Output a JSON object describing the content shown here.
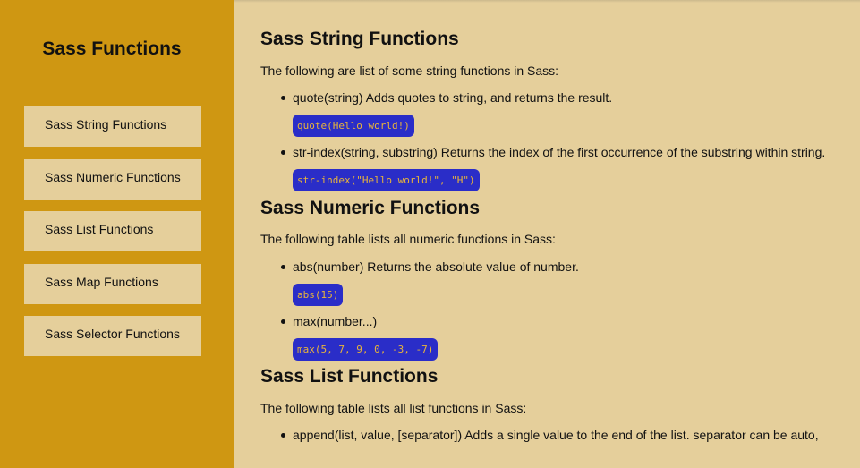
{
  "sidebar": {
    "title": "Sass Functions",
    "items": [
      {
        "label": "Sass String Functions"
      },
      {
        "label": "Sass Numeric Functions"
      },
      {
        "label": "Sass List Functions"
      },
      {
        "label": "Sass Map Functions"
      },
      {
        "label": "Sass Selector Functions"
      }
    ]
  },
  "main": {
    "sections": [
      {
        "heading": "Sass String Functions",
        "intro": "The following are list of some string functions in Sass:",
        "items": [
          {
            "text": "quote(string) Adds quotes to string, and returns the result.",
            "code": "quote(Hello world!)"
          },
          {
            "text": "str-index(string, substring) Returns the index of the first occurrence of the substring within string.",
            "code": "str-index(\"Hello world!\", \"H\")"
          }
        ]
      },
      {
        "heading": "Sass Numeric Functions",
        "intro": "The following table lists all numeric functions in Sass:",
        "items": [
          {
            "text": "abs(number) Returns the absolute value of number.",
            "code": "abs(15)"
          },
          {
            "text": "max(number...)",
            "code": "max(5, 7, 9, 0, -3, -7)"
          }
        ]
      },
      {
        "heading": "Sass List Functions",
        "intro": "The following table lists all list functions in Sass:",
        "items": [
          {
            "text": "append(list, value, [separator]) Adds a single value to the end of the list. separator can be auto,"
          }
        ]
      }
    ]
  },
  "colors": {
    "sidebar_bg": "#cf9712",
    "content_bg": "#e5cf9b",
    "code_bg": "#2a2dc8",
    "code_text": "#e8b43a"
  }
}
